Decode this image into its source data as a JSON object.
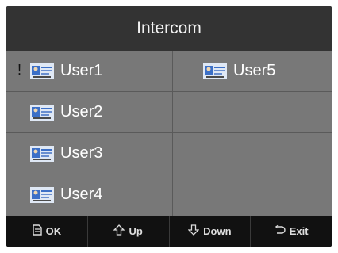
{
  "header": {
    "title": "Intercom"
  },
  "users": [
    {
      "label": "User1",
      "selected": true
    },
    {
      "label": "User2"
    },
    {
      "label": "User3"
    },
    {
      "label": "User4"
    },
    {
      "label": "User5"
    }
  ],
  "selection_marker": "!",
  "footer": {
    "ok_label": "OK",
    "up_label": "Up",
    "down_label": "Down",
    "exit_label": "Exit"
  },
  "icons": {
    "user": "user-card-icon",
    "ok": "document-icon",
    "up": "arrow-up-icon",
    "down": "arrow-down-icon",
    "exit": "back-arrow-icon"
  }
}
